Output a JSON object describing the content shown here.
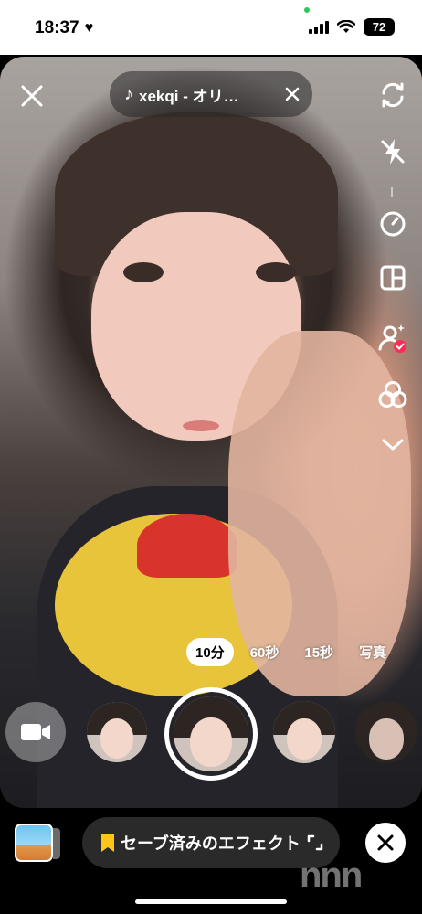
{
  "status_bar": {
    "time": "18:37",
    "battery": "72"
  },
  "top": {
    "sound_label": "xekqi - オリ…"
  },
  "right_toolbar": [
    {
      "name": "flip-camera-icon"
    },
    {
      "name": "flash-off-icon"
    },
    {
      "name": "timer-icon"
    },
    {
      "name": "layout-icon"
    },
    {
      "name": "filters-person-icon"
    },
    {
      "name": "effects-icon"
    },
    {
      "name": "chevron-down-icon"
    }
  ],
  "durations": {
    "items": [
      "10分",
      "60秒",
      "15秒",
      "写真"
    ],
    "selected": "10分"
  },
  "bottom": {
    "saved_effects_label": "セーブ済みのエフェクト",
    "watermark": "nnn"
  },
  "colors": {
    "accent_red": "#fe2c55",
    "bookmark_yellow": "#ffc61a"
  }
}
